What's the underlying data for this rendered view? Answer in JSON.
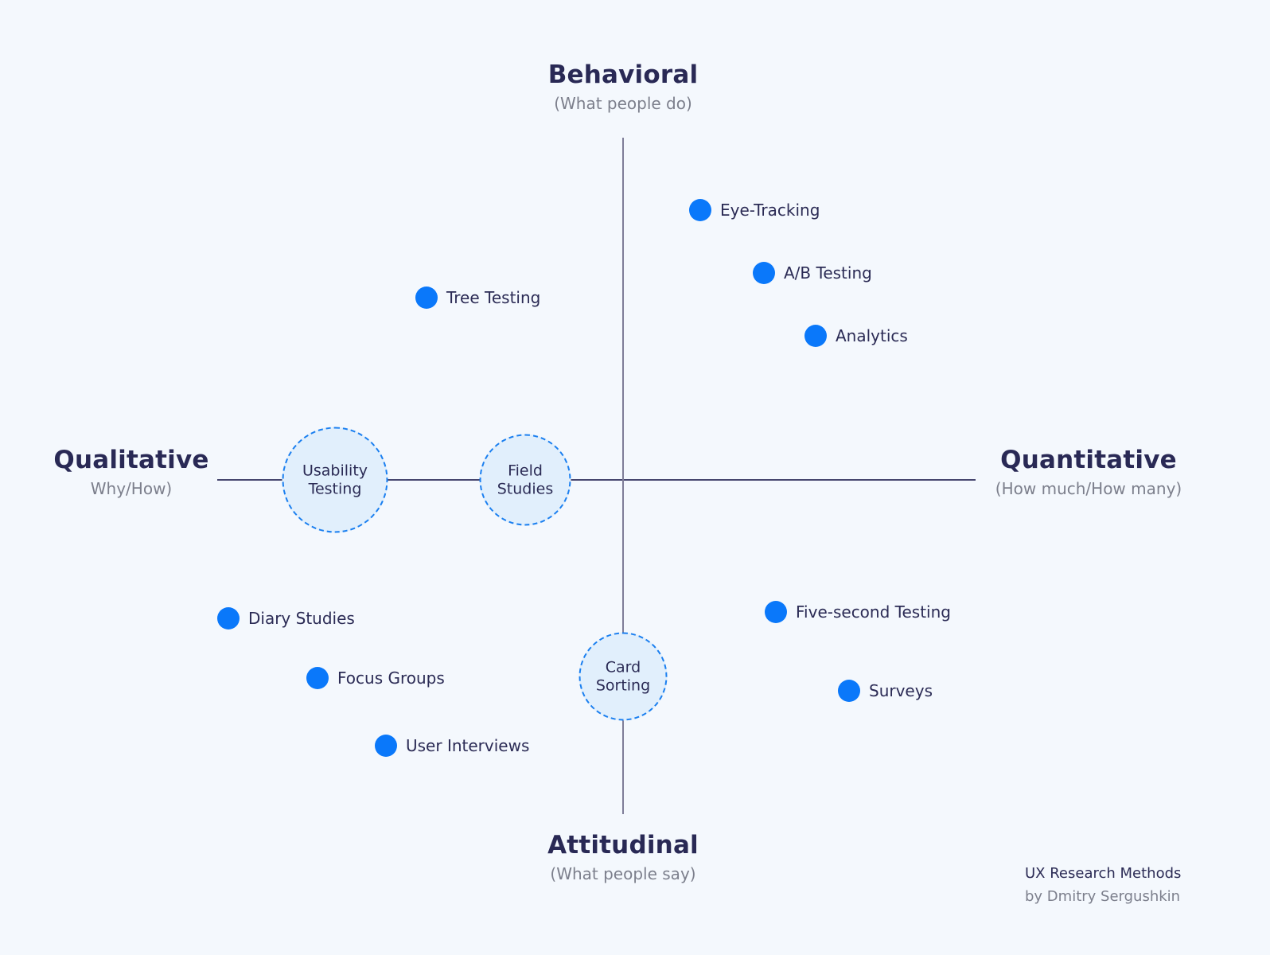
{
  "colors": {
    "background": "#f4f8fd",
    "dot": "#0a78fa",
    "bubble_fill": "#e1effc",
    "bubble_border": "#1a7ff0",
    "title_text": "#292955",
    "subtitle_text": "#7c7f8c"
  },
  "axes": {
    "top": {
      "title": "Behavioral",
      "subtitle": "(What people do)"
    },
    "bottom": {
      "title": "Attitudinal",
      "subtitle": "(What people say)"
    },
    "left": {
      "title": "Qualitative",
      "subtitle": "Why/How)"
    },
    "right": {
      "title": "Quantitative",
      "subtitle": "(How much/How many)"
    }
  },
  "methods": [
    {
      "label": "Eye-Tracking",
      "quadrant": "behavioral-quantitative"
    },
    {
      "label": "A/B Testing",
      "quadrant": "behavioral-quantitative"
    },
    {
      "label": "Analytics",
      "quadrant": "behavioral-quantitative"
    },
    {
      "label": "Tree Testing",
      "quadrant": "behavioral-qualitative"
    },
    {
      "label": "Diary Studies",
      "quadrant": "attitudinal-qualitative"
    },
    {
      "label": "Focus Groups",
      "quadrant": "attitudinal-qualitative"
    },
    {
      "label": "User Interviews",
      "quadrant": "attitudinal-qualitative"
    },
    {
      "label": "Five-second Testing",
      "quadrant": "attitudinal-quantitative"
    },
    {
      "label": "Surveys",
      "quadrant": "attitudinal-quantitative"
    }
  ],
  "bubbles": [
    {
      "line1": "Usability",
      "line2": "Testing",
      "on_axis": "qualitative"
    },
    {
      "line1": "Field",
      "line2": "Studies",
      "on_axis": "qualitative"
    },
    {
      "line1": "Card",
      "line2": "Sorting",
      "on_axis": "attitudinal"
    }
  ],
  "credit": {
    "title": "UX Research Methods",
    "author": "by Dmitry Sergushkin"
  }
}
